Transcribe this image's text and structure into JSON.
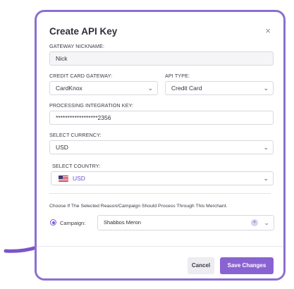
{
  "modal": {
    "title": "Create API Key",
    "close_symbol": "×"
  },
  "fields": {
    "nickname_label": "GATEWAY NICKNAME:",
    "nickname_value": "Nick",
    "gateway_label": "CREDIT CARD GATEWAY:",
    "gateway_value": "CardKnox",
    "api_type_label": "API TYPE:",
    "api_type_value": "Credit Card",
    "integration_key_label": "PROCESSING INTEGRATION KEY:",
    "integration_key_value": "******************2356",
    "currency_label": "SELECT CURRENCY:",
    "currency_value": "USD",
    "country_label": "SELECT COUNTRY:",
    "country_value": "USD"
  },
  "process": {
    "note": "Choose If The Selected Reason/Campaign Should Process Through This Merchant.",
    "radio_label": "Campaign:",
    "campaign_value": "Shabbos Meron",
    "clear_symbol": "×"
  },
  "footer": {
    "cancel_label": "Cancel",
    "save_label": "Save Changes"
  },
  "icons": {
    "chevron": "⌄"
  },
  "colors": {
    "accent": "#8a63d2",
    "frame": "#8c6fd1",
    "arrow": "#7b55c9"
  }
}
